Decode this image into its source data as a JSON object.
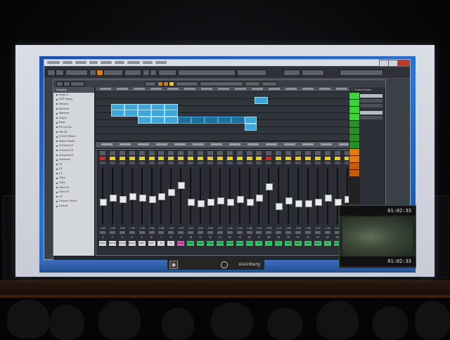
{
  "app": {
    "name": "Cubase",
    "brand": "steinberg"
  },
  "inspector": {
    "title": "Visibility",
    "items": [
      "Ambi A",
      "SOP Songs",
      "Vibrato",
      "Warmer",
      "Warmer",
      "Organ",
      "Bass",
      "FX Synths",
      "Mix Bt",
      "K-509 Effects",
      "Watch Beats",
      "Schlauch B",
      "Schlauch B",
      "Schlauch B",
      "Schlauch",
      "FX",
      "FX",
      "FX",
      "Ultra",
      "Ultra",
      "Ultra FX",
      "Ultra FX",
      "FX",
      "Groove Tracks",
      "Lorena"
    ]
  },
  "right_panel": {
    "title": "Control Room",
    "rows": [
      "Mix",
      "Main Mix",
      "",
      "",
      ""
    ]
  },
  "mixer": {
    "channels": [
      {
        "num": "1",
        "value": "-1.00",
        "name": "Tempo Ch",
        "color": "#d9d9d9",
        "button": "red"
      },
      {
        "num": "2",
        "value": "-1.00",
        "name": "Warmer",
        "color": "#d9d9d9",
        "button": "yellow"
      },
      {
        "num": "3",
        "value": "-0.40",
        "name": "Warmer",
        "color": "#d9d9d9",
        "button": "yellow"
      },
      {
        "num": "4",
        "value": "-1.00",
        "name": "Warmer",
        "color": "#d9d9d9",
        "button": "yellow"
      },
      {
        "num": "5",
        "value": "-1.00",
        "name": "Pads",
        "color": "#d9d9d9",
        "button": "yellow"
      },
      {
        "num": "6",
        "value": "-0.90",
        "name": "Pads",
        "color": "#d9d9d9",
        "button": "yellow"
      },
      {
        "num": "7",
        "value": "-0.96",
        "name": "FX Synth",
        "color": "#d9d9d9",
        "button": "yellow"
      },
      {
        "num": "8",
        "value": "-1.00",
        "name": "FX Synth",
        "color": "#d9d9d9",
        "button": "yellow"
      },
      {
        "num": "9",
        "value": "-1.00",
        "name": "K-509 FX",
        "color": "#e84fa8",
        "button": "yellow"
      },
      {
        "num": "10",
        "value": "-3.33",
        "name": "Watch",
        "color": "#2fc46a",
        "button": "yellow"
      },
      {
        "num": "11",
        "value": "-3.00",
        "name": "Beats",
        "color": "#2fc46a",
        "button": "yellow"
      },
      {
        "num": "12",
        "value": "-2.00",
        "name": "Schlauch",
        "color": "#2fc46a",
        "button": "yellow"
      },
      {
        "num": "13",
        "value": "-4.37",
        "name": "Schlauch",
        "color": "#2fc46a",
        "button": "yellow"
      },
      {
        "num": "14",
        "value": "-1.00",
        "name": "Schlauch",
        "color": "#2fc46a",
        "button": "yellow"
      },
      {
        "num": "15",
        "value": "-1.00",
        "name": "Schlauch",
        "color": "#2fc46a",
        "button": "yellow"
      },
      {
        "num": "16",
        "value": "-1.00",
        "name": "Schlauch",
        "color": "#2fc46a",
        "button": "yellow"
      },
      {
        "num": "17",
        "value": "-1.00",
        "name": "FX",
        "color": "#2fc46a",
        "button": "yellow"
      },
      {
        "num": "18",
        "value": "-1.90",
        "name": "FX",
        "color": "#2fc46a",
        "button": "red"
      },
      {
        "num": "19",
        "value": "-11.9",
        "name": "FX",
        "color": "#2fc46a",
        "button": "yellow"
      },
      {
        "num": "20",
        "value": "-3.00",
        "name": "Ultra",
        "color": "#2fc46a",
        "button": "yellow"
      },
      {
        "num": "21",
        "value": "-1.00",
        "name": "Ultra",
        "color": "#2fc46a",
        "button": "yellow"
      },
      {
        "num": "22",
        "value": "-1.00",
        "name": "Ultra FX",
        "color": "#2fc46a",
        "button": "yellow"
      },
      {
        "num": "23",
        "value": "-0.57",
        "name": "Ultra FX",
        "color": "#2fc46a",
        "button": "yellow"
      },
      {
        "num": "24",
        "value": "-1.00",
        "name": "FX",
        "color": "#2fc46a",
        "button": "yellow"
      },
      {
        "num": "25",
        "value": "-1.00",
        "name": "Groove",
        "color": "#2fc46a",
        "button": "yellow"
      },
      {
        "num": "26",
        "value": "-1.00",
        "name": "Lorena",
        "color": "#2fc46a",
        "button": "yellow"
      }
    ]
  },
  "video": {
    "time_top": "01:02:33",
    "time_bottom": "01:02:33"
  },
  "colors": {
    "event": "#3ea6d8",
    "accent_orange": "#e07a18",
    "accent_yellow": "#e8cc28",
    "meter_green": "#3cd23c"
  }
}
